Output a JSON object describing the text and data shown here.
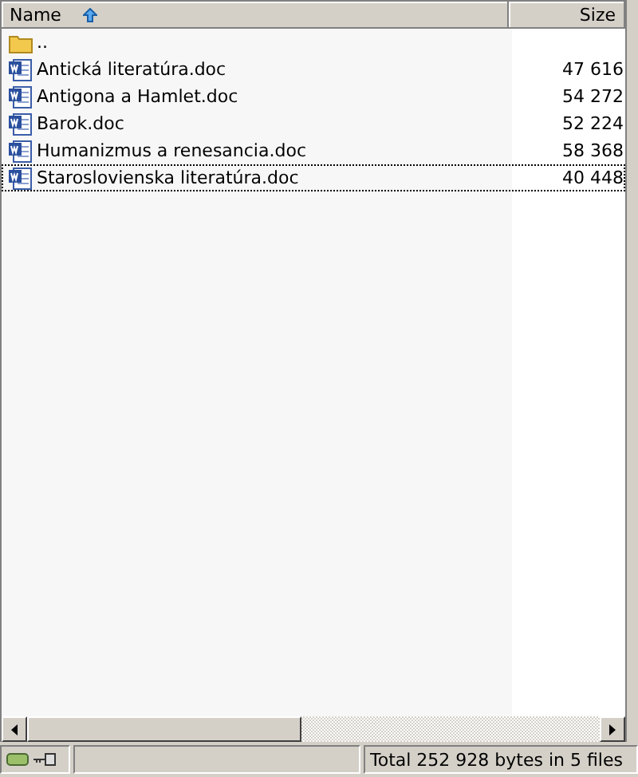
{
  "columns": [
    {
      "label": "Name",
      "sorted": true
    },
    {
      "label": "Size",
      "sorted": false
    }
  ],
  "rows": [
    {
      "kind": "parent",
      "name": "..",
      "focused": false
    },
    {
      "kind": "file",
      "name": "Antická literatúra.doc",
      "size": "47 616",
      "focused": false
    },
    {
      "kind": "file",
      "name": "Antigona a Hamlet.doc",
      "size": "54 272",
      "focused": false
    },
    {
      "kind": "file",
      "name": "Barok.doc",
      "size": "52 224",
      "focused": false
    },
    {
      "kind": "file",
      "name": "Humanizmus a renesancia.doc",
      "size": "58 368",
      "focused": false
    },
    {
      "kind": "file",
      "name": "Staroslovienska literatúra.doc",
      "size": "40 448",
      "focused": true
    }
  ],
  "status_bar": {
    "summary": "Total 252 928 bytes in 5 files"
  }
}
